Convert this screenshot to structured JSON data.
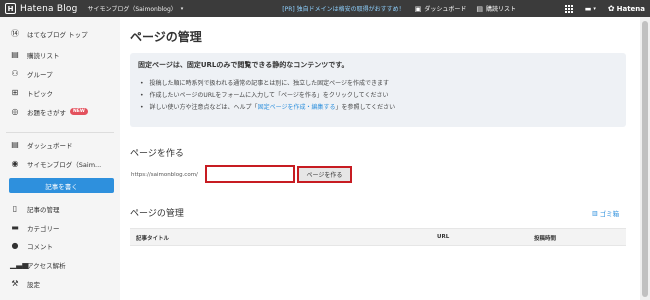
{
  "topbar": {
    "logo_text": "Hatena Blog",
    "blog_name": "サイモンブログ（Saimonblog）",
    "promo": "[PR] 独自ドメインは格安の取得がおすすめ！",
    "dashboard_label": "ダッシュボード",
    "reading_list_label": "購読リスト",
    "hatena_label": "Hatena"
  },
  "sidebar": {
    "items": [
      {
        "label": "はてなブログ トップ",
        "icon": "hatena-icon"
      },
      {
        "label": "購読リスト",
        "icon": "list-icon"
      },
      {
        "label": "グループ",
        "icon": "group-icon"
      },
      {
        "label": "トピック",
        "icon": "topic-icon"
      },
      {
        "label": "お題をさがす",
        "icon": "search-topic-icon",
        "badge": "NEW"
      },
      {
        "label": "ダッシュボード",
        "icon": "dashboard-icon"
      },
      {
        "label": "サイモンブログ（Saim...",
        "icon": "blog-icon"
      },
      {
        "label": "記事の管理",
        "icon": "document-icon"
      },
      {
        "label": "カテゴリー",
        "icon": "folder-icon"
      },
      {
        "label": "コメント",
        "icon": "comment-icon"
      },
      {
        "label": "アクセス解析",
        "icon": "chart-icon"
      },
      {
        "label": "設定",
        "icon": "wrench-icon"
      }
    ],
    "write_button": "記事を書く"
  },
  "main": {
    "title": "ページの管理",
    "info": {
      "heading": "固定ページは、固定URLのみで閲覧できる静的なコンテンツです。",
      "bullet1": "投稿した順に時系列で扱われる通常の記事とは別に、独立した固定ページを作成できます",
      "bullet2": "作成したいページのURLをフォームに入力して「ページを作る」をクリックしてください",
      "bullet3_prefix": "詳しい使い方や注意点などは、ヘルプ「",
      "bullet3_link": "固定ページを作成・編集する",
      "bullet3_suffix": "」を参照してください"
    },
    "create": {
      "title": "ページを作る",
      "url_prefix": "https://saimonblog.com/",
      "input_value": "",
      "button": "ページを作る"
    },
    "manage": {
      "title": "ページの管理",
      "trash_label": "ゴミ箱",
      "columns": [
        "記事タイトル",
        "URL",
        "投稿時間"
      ]
    }
  }
}
